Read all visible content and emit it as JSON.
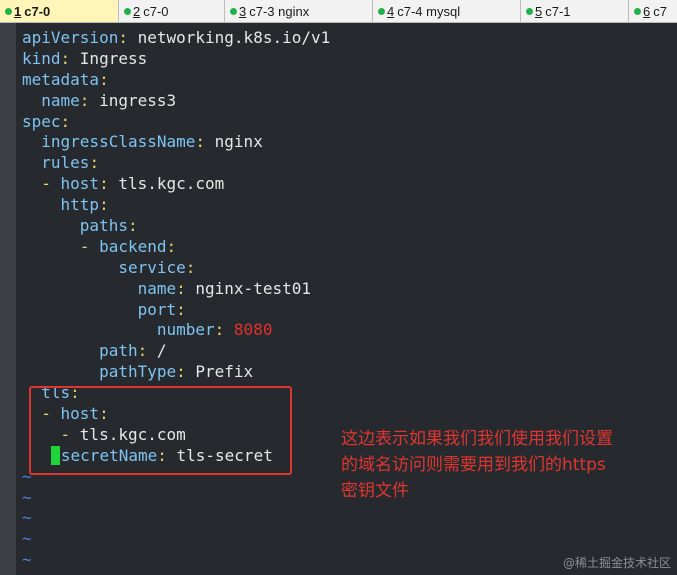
{
  "tabs": [
    {
      "num": "1",
      "label": "c7-0",
      "active": true
    },
    {
      "num": "2",
      "label": "c7-0",
      "active": false
    },
    {
      "num": "3",
      "label": "c7-3 nginx",
      "active": false
    },
    {
      "num": "4",
      "label": "c7-4 mysql",
      "active": false
    },
    {
      "num": "5",
      "label": "c7-1",
      "active": false
    },
    {
      "num": "6",
      "label": "c7",
      "active": false
    }
  ],
  "editor": {
    "lines": [
      [
        {
          "t": "apiVersion",
          "c": "k"
        },
        {
          "t": ": ",
          "c": "p"
        },
        {
          "t": "networking.k8s.io/v1",
          "c": "v"
        }
      ],
      [
        {
          "t": "kind",
          "c": "k"
        },
        {
          "t": ": ",
          "c": "p"
        },
        {
          "t": "Ingress",
          "c": "v"
        }
      ],
      [
        {
          "t": "metadata",
          "c": "k"
        },
        {
          "t": ":",
          "c": "p"
        }
      ],
      [
        {
          "t": "  "
        },
        {
          "t": "name",
          "c": "k"
        },
        {
          "t": ": ",
          "c": "p"
        },
        {
          "t": "ingress3",
          "c": "v"
        }
      ],
      [
        {
          "t": "spec",
          "c": "k"
        },
        {
          "t": ":",
          "c": "p"
        }
      ],
      [
        {
          "t": "  "
        },
        {
          "t": "ingressClassName",
          "c": "k"
        },
        {
          "t": ": ",
          "c": "p"
        },
        {
          "t": "nginx",
          "c": "v"
        }
      ],
      [
        {
          "t": "  "
        },
        {
          "t": "rules",
          "c": "k"
        },
        {
          "t": ":",
          "c": "p"
        }
      ],
      [
        {
          "t": "  "
        },
        {
          "t": "- ",
          "c": "p"
        },
        {
          "t": "host",
          "c": "k"
        },
        {
          "t": ": ",
          "c": "p"
        },
        {
          "t": "tls.kgc.com",
          "c": "v"
        }
      ],
      [
        {
          "t": "    "
        },
        {
          "t": "http",
          "c": "k"
        },
        {
          "t": ":",
          "c": "p"
        }
      ],
      [
        {
          "t": "      "
        },
        {
          "t": "paths",
          "c": "k"
        },
        {
          "t": ":",
          "c": "p"
        }
      ],
      [
        {
          "t": "      "
        },
        {
          "t": "- ",
          "c": "p"
        },
        {
          "t": "backend",
          "c": "k"
        },
        {
          "t": ":",
          "c": "p"
        }
      ],
      [
        {
          "t": "          "
        },
        {
          "t": "service",
          "c": "k"
        },
        {
          "t": ":",
          "c": "p"
        }
      ],
      [
        {
          "t": "            "
        },
        {
          "t": "name",
          "c": "k"
        },
        {
          "t": ": ",
          "c": "p"
        },
        {
          "t": "nginx-test01",
          "c": "v"
        }
      ],
      [
        {
          "t": "            "
        },
        {
          "t": "port",
          "c": "k"
        },
        {
          "t": ":",
          "c": "p"
        }
      ],
      [
        {
          "t": "              "
        },
        {
          "t": "number",
          "c": "k"
        },
        {
          "t": ": ",
          "c": "p"
        },
        {
          "t": "8080",
          "c": "num"
        }
      ],
      [
        {
          "t": "        "
        },
        {
          "t": "path",
          "c": "k"
        },
        {
          "t": ": ",
          "c": "p"
        },
        {
          "t": "/",
          "c": "v"
        }
      ],
      [
        {
          "t": "        "
        },
        {
          "t": "pathType",
          "c": "k"
        },
        {
          "t": ": ",
          "c": "p"
        },
        {
          "t": "Prefix",
          "c": "v"
        }
      ],
      [
        {
          "t": "  "
        },
        {
          "t": "tls",
          "c": "k"
        },
        {
          "t": ":",
          "c": "p"
        }
      ],
      [
        {
          "t": "  "
        },
        {
          "t": "- ",
          "c": "p"
        },
        {
          "t": "host",
          "c": "k"
        },
        {
          "t": ":",
          "c": "p"
        }
      ],
      [
        {
          "t": "    "
        },
        {
          "t": "- ",
          "c": "p"
        },
        {
          "t": "tls.kgc.com",
          "c": "v"
        }
      ],
      [
        {
          "t": "   "
        },
        {
          "t": "",
          "c": "cursor"
        },
        {
          "t": "secretName",
          "c": "k"
        },
        {
          "t": ": ",
          "c": "p"
        },
        {
          "t": "tls-secret",
          "c": "v"
        }
      ],
      [
        {
          "t": "~",
          "c": "tilde"
        }
      ],
      [
        {
          "t": "~",
          "c": "tilde"
        }
      ],
      [
        {
          "t": "~",
          "c": "tilde"
        }
      ],
      [
        {
          "t": "~",
          "c": "tilde"
        }
      ],
      [
        {
          "t": "~",
          "c": "tilde"
        }
      ]
    ]
  },
  "annotation": {
    "text": "这边表示如果我们我们使用我们设置\n的域名访问则需要用到我们的https\n密钥文件",
    "color": "#e0352f"
  },
  "watermark": "@稀土掘金技术社区",
  "colors": {
    "background": "#262a2e",
    "key": "#7ec3f0",
    "punct": "#e6d36e",
    "number": "#e23030",
    "cursor": "#1fd33a",
    "active_tab": "#fff5b8",
    "tab_dot": "#22b14c"
  }
}
